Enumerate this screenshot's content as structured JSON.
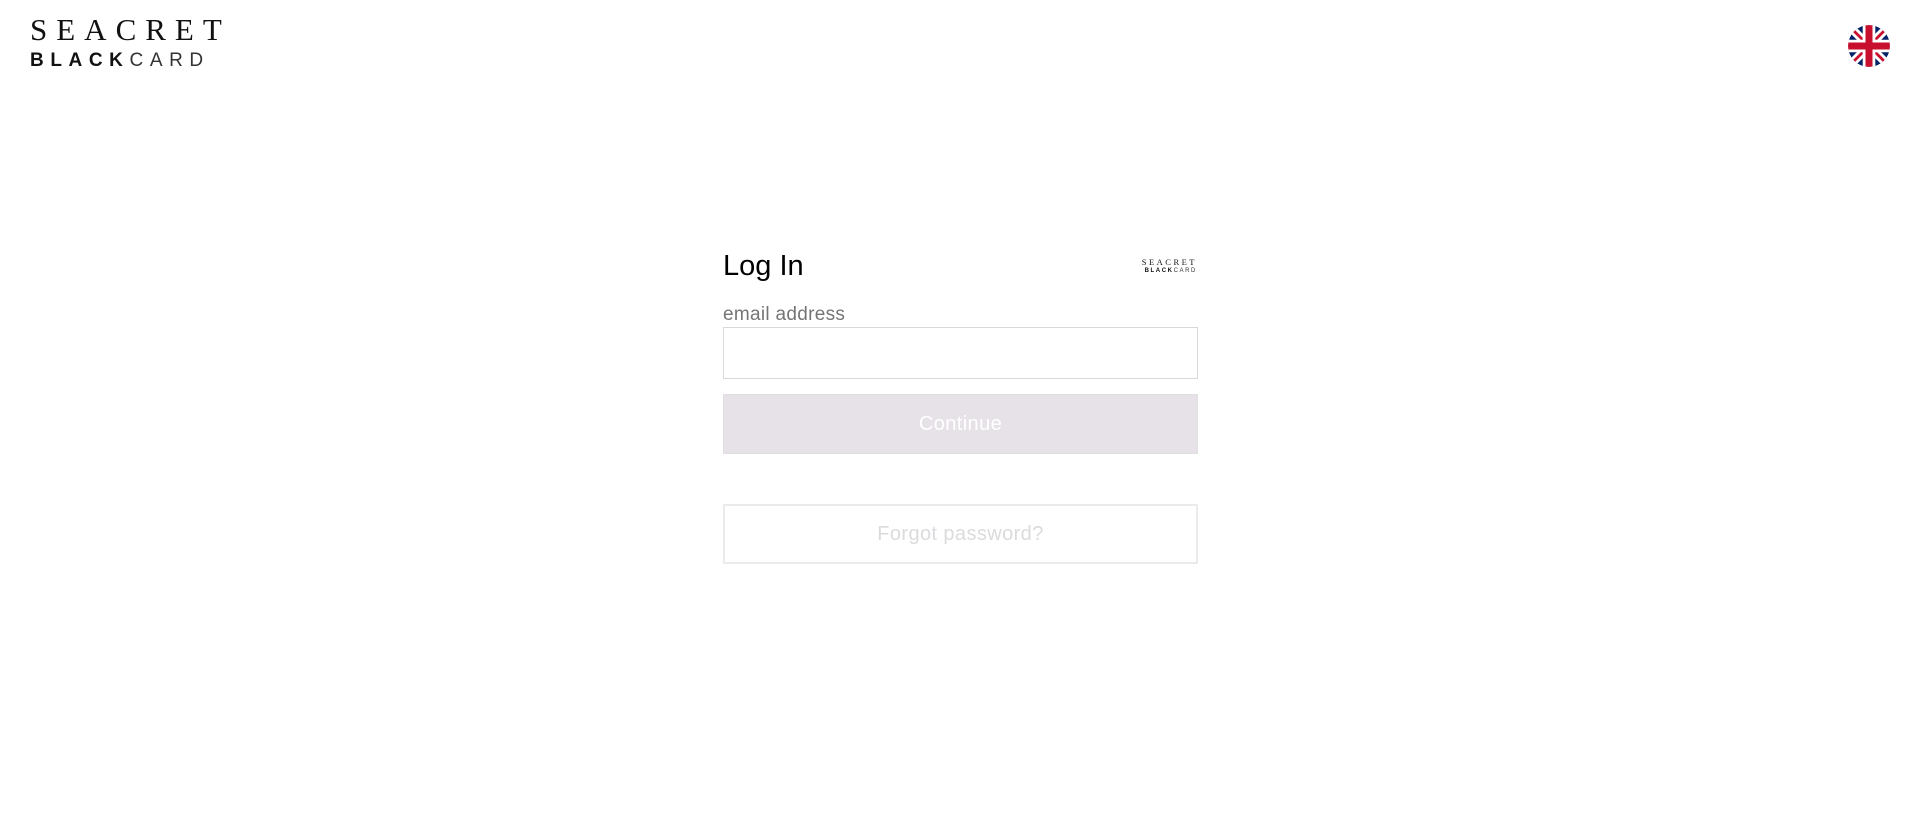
{
  "header": {
    "logo_line1": "SEACRET",
    "logo_line2_bold": "BLACK",
    "logo_line2_light": "CARD",
    "language_flag": "uk-flag-icon"
  },
  "login": {
    "title": "Log In",
    "mini_logo_line1": "SEACRET",
    "mini_logo_line2_bold": "BLACK",
    "mini_logo_line2_light": "CARD",
    "email_label": "email address",
    "email_value": "",
    "email_placeholder": "",
    "continue_label": "Continue",
    "forgot_label": "Forgot password?"
  },
  "colors": {
    "background": "#ffffff",
    "continue_button_bg": "#e6e2e7",
    "forgot_text": "#dcdadd",
    "label_text": "#757575",
    "flag_blue": "#012169",
    "flag_red": "#C8102E"
  }
}
